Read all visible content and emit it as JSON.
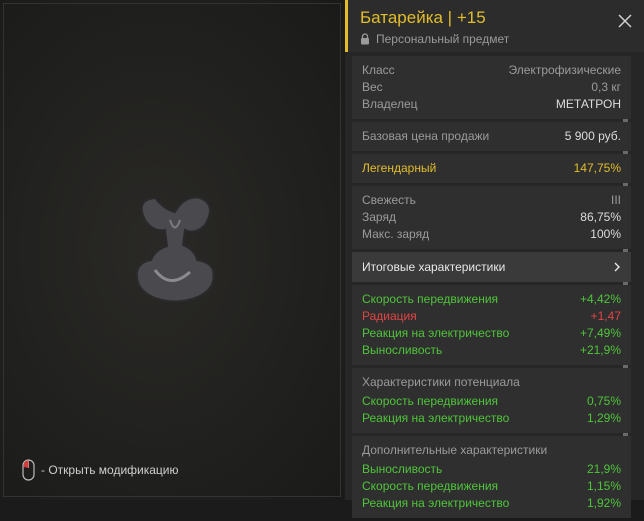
{
  "hint": {
    "text": "- Открыть модификацию"
  },
  "item": {
    "title": "Батарейка | +15",
    "subtitle": "Персональный предмет"
  },
  "basic": [
    {
      "label": "Класс",
      "value": "Электрофизические"
    },
    {
      "label": "Вес",
      "value": "0,3 кг"
    },
    {
      "label": "Владелец",
      "value": "МЕТАТРОН"
    }
  ],
  "price": {
    "label": "Базовая цена продажи",
    "value": "5 900 руб."
  },
  "rarity": {
    "label": "Легендарный",
    "value": "147,75%"
  },
  "status": [
    {
      "label": "Свежесть",
      "value": "III"
    },
    {
      "label": "Заряд",
      "value": "86,75%"
    },
    {
      "label": "Макс. заряд",
      "value": "100%"
    }
  ],
  "totals": {
    "label": "Итоговые характеристики"
  },
  "final_stats": [
    {
      "label": "Скорость передвижения",
      "value": "+4,42%",
      "tone": "green"
    },
    {
      "label": "Радиация",
      "value": "+1,47",
      "tone": "red"
    },
    {
      "label": "Реакция на электричество",
      "value": "+7,49%",
      "tone": "green"
    },
    {
      "label": "Выносливость",
      "value": "+21,9%",
      "tone": "green"
    }
  ],
  "potential": {
    "title": "Характеристики потенциала",
    "rows": [
      {
        "label": "Скорость передвижения",
        "value": "0,75%"
      },
      {
        "label": "Реакция на электричество",
        "value": "1,29%"
      }
    ]
  },
  "additional": {
    "title": "Дополнительные характеристики",
    "rows": [
      {
        "label": "Выносливость",
        "value": "21,9%"
      },
      {
        "label": "Скорость передвижения",
        "value": "1,15%"
      },
      {
        "label": "Реакция на электричество",
        "value": "1,92%"
      }
    ]
  },
  "colors": {
    "accent": "#e3bd2b",
    "positive": "#4fc53a",
    "negative": "#e04545"
  },
  "icons": {
    "close": "close-icon",
    "lock": "lock-icon",
    "mouse": "mouse-icon",
    "chevron": "chevron-right-icon"
  }
}
